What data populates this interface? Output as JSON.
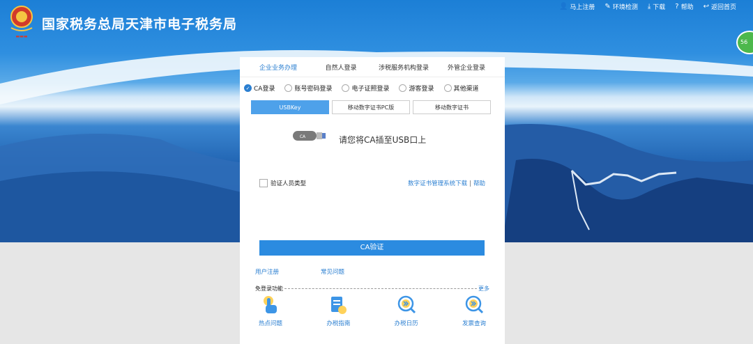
{
  "header": {
    "title": "国家税务总局天津市电子税务局",
    "links": [
      {
        "label": "马上注册",
        "icon": "user-icon"
      },
      {
        "label": "环境检测",
        "icon": "wrench-icon"
      },
      {
        "label": "下载",
        "icon": "download-icon"
      },
      {
        "label": "帮助",
        "icon": "help-icon"
      },
      {
        "label": "返回首页",
        "icon": "return-icon"
      }
    ],
    "side_badge": "56"
  },
  "login": {
    "tabs": [
      "企业业务办理",
      "自然人登录",
      "涉税服务机构登录",
      "外管企业登录"
    ],
    "active_tab": 0,
    "methods": [
      "CA登录",
      "账号密码登录",
      "电子证照登录",
      "游客登录",
      "其他渠道"
    ],
    "selected_method": 0,
    "subtabs": [
      "USBKey",
      "移动数字证书PC版",
      "移动数字证书"
    ],
    "active_subtab": 0,
    "usb_label": "CA",
    "usb_prompt": "请您将CA插至USB口上",
    "verify_label": "验证人员类型",
    "cert_download_link": "数字证书管理系统下载",
    "separator": "|",
    "help_link": "帮助",
    "submit_label": "CA验证",
    "register_link": "用户注册",
    "faq_link": "常见问题",
    "free_login_label": "免登录功能",
    "more_link": "更多",
    "quick_items": [
      {
        "label": "热点问题",
        "icon": "hand-pointer-icon"
      },
      {
        "label": "办税指南",
        "icon": "guide-document-icon"
      },
      {
        "label": "办税日历",
        "icon": "calendar-search-icon"
      },
      {
        "label": "发票查询",
        "icon": "invoice-search-icon"
      }
    ]
  },
  "colors": {
    "accent": "#2b7fd1",
    "button": "#2b8be0",
    "hero": "#1c7fd6"
  }
}
